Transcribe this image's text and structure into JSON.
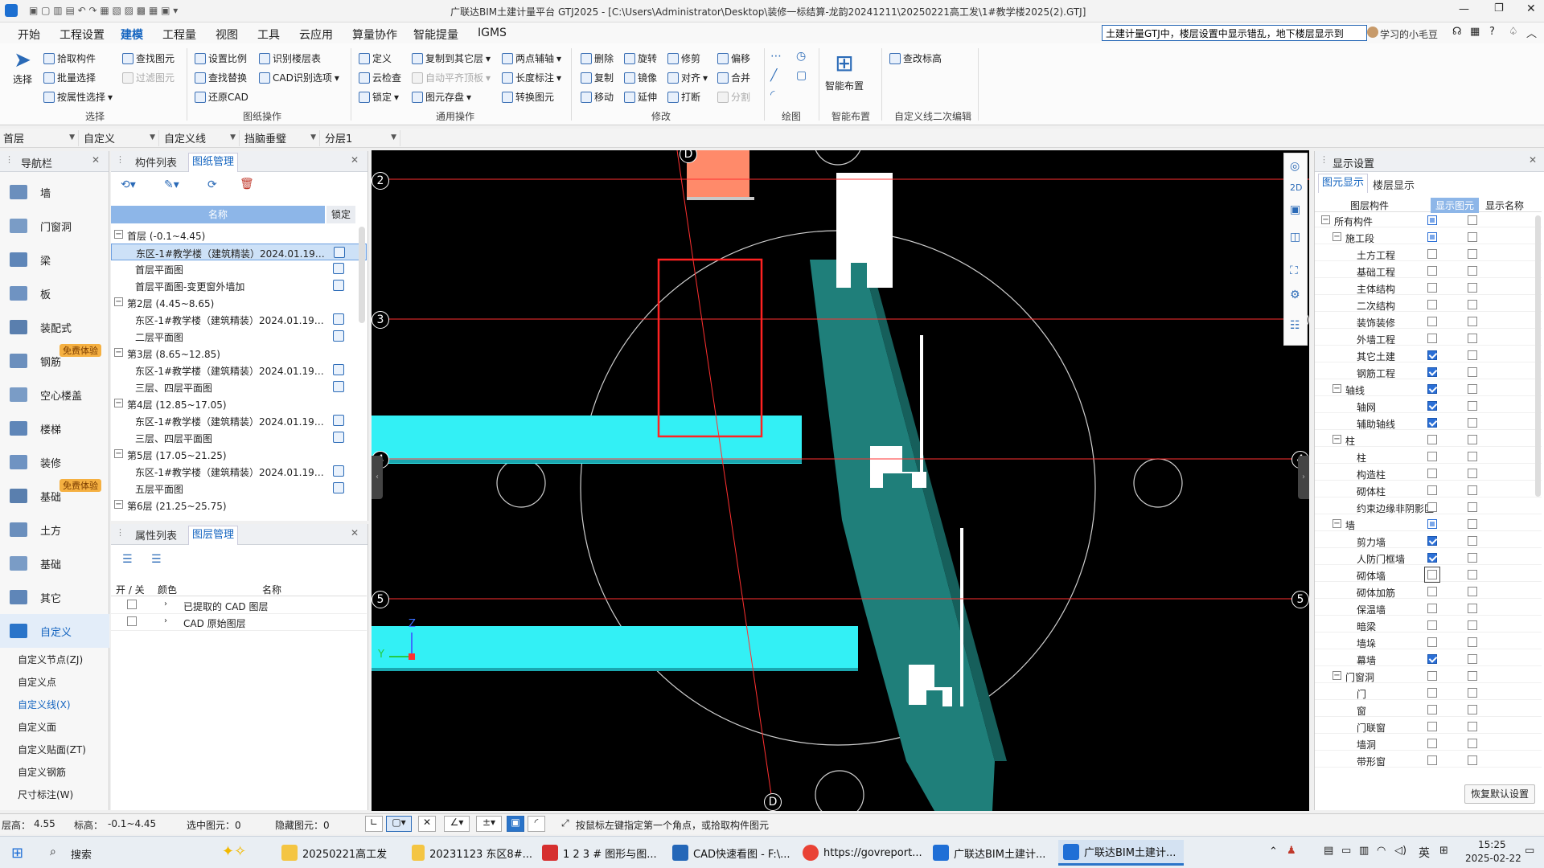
{
  "window": {
    "title": "广联达BIM土建计量平台 GTJ2025 - [C:\\Users\\Administrator\\Desktop\\装修一标结算-龙韵20241211\\20250221高工发\\1#教学楼2025(2).GTJ]",
    "search_value": "土建计量GTJ中，楼层设置中显示错乱，地下楼层显示到",
    "user_name": "学习的小毛豆",
    "help": "?"
  },
  "menu": [
    "开始",
    "工程设置",
    "建模",
    "工程量",
    "视图",
    "工具",
    "云应用",
    "算量协作",
    "智能提量",
    "IGMS"
  ],
  "menu_active": "建模",
  "ribbon": {
    "select_big": "选择",
    "select_items": [
      "拾取构件",
      "批量选择",
      "按属性选择"
    ],
    "select_group": "选择",
    "find_items": [
      "查找图元",
      "过滤图元"
    ],
    "draw_ops_items": [
      "设置比例",
      "查找替换",
      "还原CAD",
      "识别楼层表",
      "CAD识别选项"
    ],
    "draw_ops_group": "图纸操作",
    "common_items": [
      "定义",
      "云检查",
      "锁定",
      "复制到其它层",
      "自动平齐顶板",
      "图元存盘",
      "两点辅轴",
      "长度标注",
      "转换图元"
    ],
    "common_group": "通用操作",
    "modify_items": [
      "删除",
      "复制",
      "移动",
      "旋转",
      "镜像",
      "延伸",
      "修剪",
      "对齐",
      "打断",
      "偏移",
      "合并",
      "分割"
    ],
    "modify_group": "修改",
    "draw_group": "绘图",
    "smart_big": "智能布置",
    "smart_group": "智能布置",
    "elev_item": "查改标高",
    "custom_group": "自定义线二次编辑"
  },
  "filters": [
    "首层",
    "自定义",
    "自定义线",
    "挡脑垂璧",
    "分层1"
  ],
  "nav": {
    "title": "导航栏",
    "items": [
      "墙",
      "门窗洞",
      "梁",
      "板",
      "装配式",
      "钢筋",
      "空心楼盖",
      "楼梯",
      "装修",
      "基础",
      "土方",
      "基础",
      "其它",
      "自定义"
    ],
    "badge": "免费体验",
    "sub_items": [
      "自定义节点(ZJ)",
      "自定义点",
      "自定义线(X)",
      "自定义面",
      "自定义贴面(ZT)",
      "自定义钢筋",
      "尺寸标注(W)"
    ]
  },
  "drawing_panel": {
    "tabs": [
      "构件列表",
      "图纸管理"
    ],
    "col_name": "名称",
    "col_lock": "锁定",
    "rows": [
      {
        "type": "floor",
        "text": "首层 (-0.1~4.45)"
      },
      {
        "type": "item",
        "text": "东区-1#教学楼（建筑精装）2024.01.19_...",
        "selected": true
      },
      {
        "type": "item",
        "text": "首层平面图"
      },
      {
        "type": "item",
        "text": "首层平面图-变更窗外墙加"
      },
      {
        "type": "floor",
        "text": "第2层 (4.45~8.65)"
      },
      {
        "type": "item",
        "text": "东区-1#教学楼（建筑精装）2024.01.19_..."
      },
      {
        "type": "item",
        "text": "二层平面图"
      },
      {
        "type": "floor",
        "text": "第3层 (8.65~12.85)"
      },
      {
        "type": "item",
        "text": "东区-1#教学楼（建筑精装）2024.01.19_..."
      },
      {
        "type": "item",
        "text": "三层、四层平面图"
      },
      {
        "type": "floor",
        "text": "第4层 (12.85~17.05)"
      },
      {
        "type": "item",
        "text": "东区-1#教学楼（建筑精装）2024.01.19_..."
      },
      {
        "type": "item",
        "text": "三层、四层平面图"
      },
      {
        "type": "floor",
        "text": "第5层 (17.05~21.25)"
      },
      {
        "type": "item",
        "text": "东区-1#教学楼（建筑精装）2024.01.19_..."
      },
      {
        "type": "item",
        "text": "五层平面图"
      },
      {
        "type": "floor",
        "text": "第6层 (21.25~25.75)"
      }
    ]
  },
  "layer_panel": {
    "tabs": [
      "属性列表",
      "图层管理"
    ],
    "col_toggle": "开 / 关",
    "col_color": "颜色",
    "col_name": "名称",
    "rows": [
      "已提取的 CAD 图层",
      "CAD 原始图层"
    ]
  },
  "viewport": {
    "axis_labels": [
      "D",
      "2",
      "3",
      "3",
      "4",
      "4",
      "5",
      "5",
      "D"
    ],
    "coord_y": "Y",
    "coord_z": "Z"
  },
  "display_panel": {
    "title": "显示设置",
    "tabs": [
      "图元显示",
      "楼层显示"
    ],
    "col_layer": "图层构件",
    "col_show": "显示图元",
    "col_name": "显示名称",
    "rows": [
      {
        "label": "所有构件",
        "level": 0,
        "exp": "-",
        "show": "partial"
      },
      {
        "label": "施工段",
        "level": 1,
        "exp": "-",
        "show": "partial"
      },
      {
        "label": "土方工程",
        "level": 2,
        "show": "off"
      },
      {
        "label": "基础工程",
        "level": 2,
        "show": "off"
      },
      {
        "label": "主体结构",
        "level": 2,
        "show": "off"
      },
      {
        "label": "二次结构",
        "level": 2,
        "show": "off"
      },
      {
        "label": "装饰装修",
        "level": 2,
        "show": "off"
      },
      {
        "label": "外墙工程",
        "level": 2,
        "show": "off"
      },
      {
        "label": "其它土建",
        "level": 2,
        "show": "on"
      },
      {
        "label": "钢筋工程",
        "level": 2,
        "show": "on"
      },
      {
        "label": "轴线",
        "level": 1,
        "exp": "-",
        "show": "on"
      },
      {
        "label": "轴网",
        "level": 2,
        "show": "on"
      },
      {
        "label": "辅助轴线",
        "level": 2,
        "show": "on"
      },
      {
        "label": "柱",
        "level": 1,
        "exp": "-",
        "show": "off"
      },
      {
        "label": "柱",
        "level": 2,
        "show": "off"
      },
      {
        "label": "构造柱",
        "level": 2,
        "show": "off"
      },
      {
        "label": "砌体柱",
        "level": 2,
        "show": "off"
      },
      {
        "label": "约束边缘非阴影区",
        "level": 2,
        "show": "off"
      },
      {
        "label": "墙",
        "level": 1,
        "exp": "-",
        "show": "partial"
      },
      {
        "label": "剪力墙",
        "level": 2,
        "show": "on"
      },
      {
        "label": "人防门框墙",
        "level": 2,
        "show": "on"
      },
      {
        "label": "砌体墙",
        "level": 2,
        "show": "off",
        "focus": true
      },
      {
        "label": "砌体加筋",
        "level": 2,
        "show": "off"
      },
      {
        "label": "保温墙",
        "level": 2,
        "show": "off"
      },
      {
        "label": "暗梁",
        "level": 2,
        "show": "off"
      },
      {
        "label": "墙垛",
        "level": 2,
        "show": "off"
      },
      {
        "label": "幕墙",
        "level": 2,
        "show": "on"
      },
      {
        "label": "门窗洞",
        "level": 1,
        "exp": "-",
        "show": "off"
      },
      {
        "label": "门",
        "level": 2,
        "show": "off"
      },
      {
        "label": "窗",
        "level": 2,
        "show": "off"
      },
      {
        "label": "门联窗",
        "level": 2,
        "show": "off"
      },
      {
        "label": "墙洞",
        "level": 2,
        "show": "off"
      },
      {
        "label": "带形窗",
        "level": 2,
        "show": "off"
      }
    ],
    "restore_button": "恢复默认设置"
  },
  "status": {
    "floor_height": "层高：",
    "floor_height_val": "4.55",
    "elevation": "标高：",
    "elevation_val": "-0.1~4.45",
    "selected": "选中图元：0",
    "hidden": "隐藏图元：0",
    "hint": "按鼠标左键指定第一个角点，或拾取构件图元"
  },
  "taskbar": {
    "search": "搜索",
    "items": [
      "20250221高工发",
      "20231123 东区8#...",
      "1 2 3 # 图形与图...",
      "CAD快速看图 - F:\\...",
      "https://govreport...",
      "广联达BIM土建计...",
      "广联达BIM土建计..."
    ],
    "ime": "英",
    "time": "15:25",
    "date": "2025-02-22"
  },
  "colors": {
    "accent": "#1565c0",
    "viewport_bg": "#000000",
    "cyan_beam": "#33f0f5",
    "teal_wall": "#1f7f7a",
    "grid_red": "#ff3030",
    "highlight_box": "#ff2222"
  }
}
